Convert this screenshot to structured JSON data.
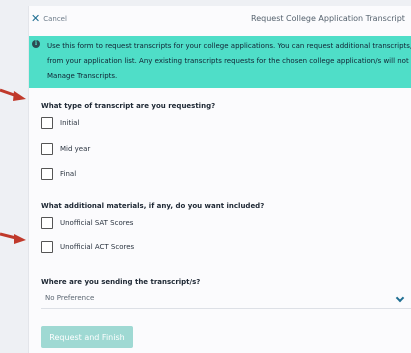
{
  "header": {
    "cancel_label": "Cancel",
    "title": "Request College Application Transcript"
  },
  "banner": {
    "text_line1": "Use this form to request transcripts for your college applications. You can request additional transcripts, se",
    "text_line2": "from your application list. Any existing transcripts requests for the chosen college application/s will not be",
    "text_line3": "Manage Transcripts."
  },
  "transcript_type": {
    "question": "What type of transcript are you requesting?",
    "options": [
      {
        "label": "Initial",
        "checked": false
      },
      {
        "label": "Mid year",
        "checked": false
      },
      {
        "label": "Final",
        "checked": false
      }
    ]
  },
  "materials": {
    "question": "What additional materials, if any, do you want included?",
    "options": [
      {
        "label": "Unofficial SAT Scores",
        "checked": false
      },
      {
        "label": "Unofficial ACT Scores",
        "checked": false
      }
    ]
  },
  "destination": {
    "question": "Where are you sending the transcript/s?",
    "selected": "No Preference"
  },
  "submit_label": "Request and Finish",
  "colors": {
    "banner": "#4fdec8",
    "accent": "#1f6e92",
    "button_disabled": "#9fd9d3",
    "annotation_arrow": "#c0392b"
  }
}
